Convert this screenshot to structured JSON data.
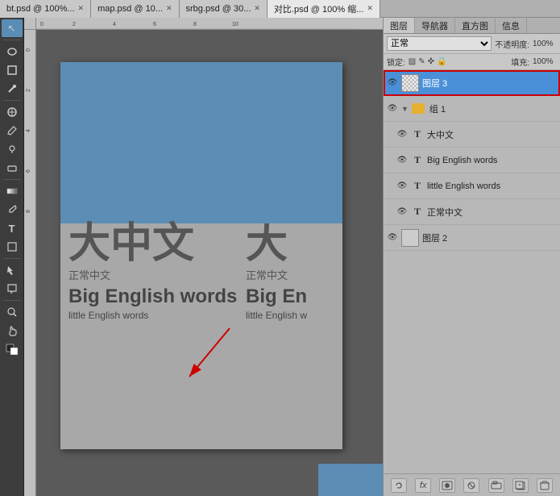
{
  "tabs": [
    {
      "label": "bt.psd @ 100%...",
      "active": false
    },
    {
      "label": "map.psd @ 10...",
      "active": false
    },
    {
      "label": "srbg.psd @ 30...",
      "active": false
    },
    {
      "label": "对比.psd @ 100%  缩...",
      "active": true
    }
  ],
  "panel_tabs": [
    {
      "label": "图层",
      "active": true
    },
    {
      "label": "导航器"
    },
    {
      "label": "直方图"
    },
    {
      "label": "信息"
    }
  ],
  "mode": "正常",
  "opacity_label": "不透明度:",
  "opacity_value": "100%",
  "lock_label": "锁定:",
  "fill_label": "填充:",
  "fill_value": "100%",
  "layers": [
    {
      "id": "layer3",
      "name": "图层 3",
      "type": "raster",
      "visible": true,
      "selected": true,
      "group": false,
      "indent": 0
    },
    {
      "id": "group1",
      "name": "组 1",
      "type": "group",
      "visible": true,
      "selected": false,
      "group": true,
      "expanded": true,
      "indent": 0
    },
    {
      "id": "big-chinese",
      "name": "大中文",
      "type": "text",
      "visible": true,
      "selected": false,
      "group": false,
      "indent": 1
    },
    {
      "id": "big-english",
      "name": "Big English words",
      "type": "text",
      "visible": true,
      "selected": false,
      "group": false,
      "indent": 1
    },
    {
      "id": "little-english",
      "name": "little English words",
      "type": "text",
      "visible": true,
      "selected": false,
      "group": false,
      "indent": 1
    },
    {
      "id": "normal-chinese",
      "name": "正常中文",
      "type": "text",
      "visible": true,
      "selected": false,
      "group": false,
      "indent": 1
    },
    {
      "id": "layer2",
      "name": "图层 2",
      "type": "raster",
      "visible": true,
      "selected": false,
      "group": false,
      "indent": 0
    }
  ],
  "canvas": {
    "big_chinese_left": "大中文",
    "big_chinese_right": "大",
    "normal_chinese_left": "正常中文",
    "normal_chinese_right": "正常中文",
    "big_english_left": "Big English words",
    "big_english_right": "Big En",
    "little_english_left": "little English words",
    "little_english_right": "little English w"
  },
  "toolbar_tools": [
    "↖",
    "✂",
    "⟲",
    "◻",
    "⊗",
    "✒",
    "T",
    "⟡",
    "✎",
    "△",
    "✱",
    "🔍",
    "🤚",
    "⬚"
  ]
}
